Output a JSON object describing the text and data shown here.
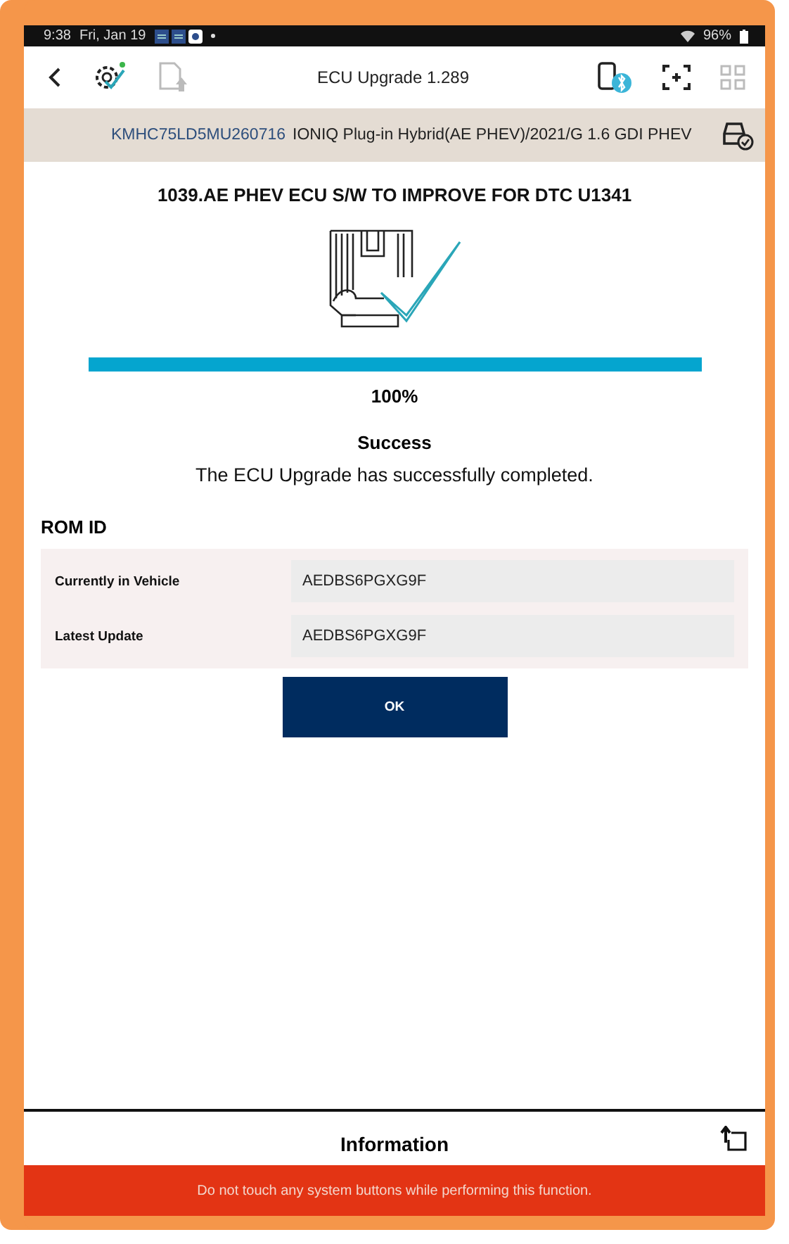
{
  "status_bar": {
    "time": "9:38",
    "date": "Fri, Jan 19",
    "battery": "96%"
  },
  "toolbar": {
    "title": "ECU Upgrade 1.289"
  },
  "vehicle": {
    "vin": "KMHC75LD5MU260716",
    "description": "IONIQ Plug-in Hybrid(AE PHEV)/2021/G 1.6 GDI PHEV"
  },
  "procedure_title": "1039.AE PHEV ECU S/W TO IMPROVE FOR DTC U1341",
  "progress": {
    "level": 1,
    "reading": "100%"
  },
  "result": {
    "title": "Success",
    "message": "The ECU Upgrade has successfully completed."
  },
  "rom_id": {
    "heading": "ROM ID",
    "rows": [
      {
        "label": "Currently in Vehicle",
        "value": "AEDBS6PGXG9F"
      },
      {
        "label": "Latest Update",
        "value": "AEDBS6PGXG9F"
      }
    ]
  },
  "ok_button": "OK",
  "information": {
    "title": "Information"
  },
  "warning": "Do not touch any system buttons while performing this function."
}
